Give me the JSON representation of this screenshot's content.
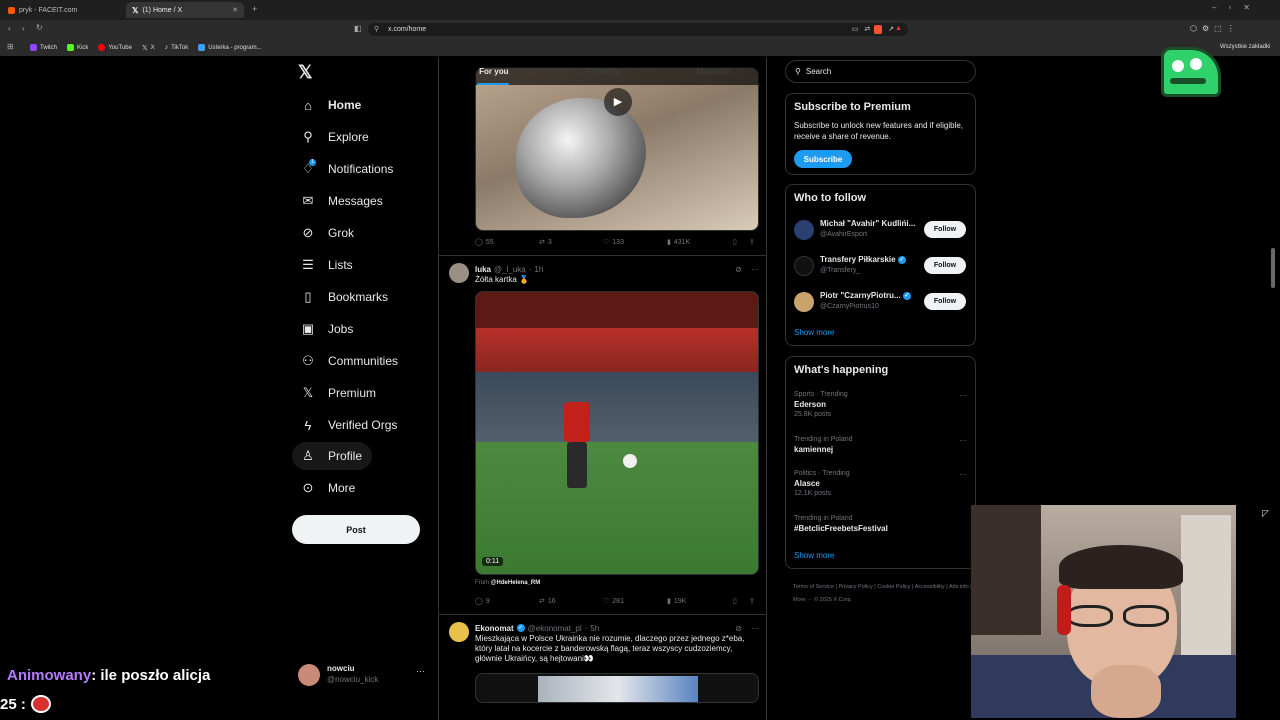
{
  "browser": {
    "tabs": [
      {
        "label": "pryk - FACEIT.com",
        "color": "#ff5500"
      },
      {
        "label": "(1) Home / X",
        "color": "#ffffff"
      }
    ],
    "url": "x.com/home",
    "bookmarks": [
      "Twitch",
      "Kick",
      "YouTube",
      "X",
      "TikTok",
      "Usterka - program..."
    ],
    "bookmarks_right": "Wszystkie zakładki"
  },
  "nav": {
    "items": [
      {
        "label": "Home",
        "icon": "home-icon"
      },
      {
        "label": "Explore",
        "icon": "search-icon"
      },
      {
        "label": "Notifications",
        "icon": "bell-icon",
        "badge": "1"
      },
      {
        "label": "Messages",
        "icon": "envelope-icon"
      },
      {
        "label": "Grok",
        "icon": "grok-icon"
      },
      {
        "label": "Lists",
        "icon": "list-icon"
      },
      {
        "label": "Bookmarks",
        "icon": "bookmark-icon"
      },
      {
        "label": "Jobs",
        "icon": "briefcase-icon"
      },
      {
        "label": "Communities",
        "icon": "people-icon"
      },
      {
        "label": "Premium",
        "icon": "x-logo-icon"
      },
      {
        "label": "Verified Orgs",
        "icon": "lightning-icon"
      },
      {
        "label": "Profile",
        "icon": "person-icon"
      },
      {
        "label": "More",
        "icon": "more-circle-icon"
      }
    ],
    "post_label": "Post",
    "account": {
      "name": "nowciu",
      "handle": "@nowciu_kick"
    }
  },
  "timeline": {
    "tabs": [
      "For you",
      "Following",
      "Mamm0n"
    ],
    "tweet1": {
      "replies": "55",
      "reposts": "3",
      "likes": "133",
      "views": "431K"
    },
    "tweet2": {
      "name": "luka",
      "handle": "@_l_uka",
      "time": "1h",
      "text": "Żółta kartka 🏅",
      "duration": "0:11",
      "from_label": "From",
      "from": "@HdeHelena_RM",
      "replies": "9",
      "reposts": "16",
      "likes": "281",
      "views": "19K"
    },
    "tweet3": {
      "name": "Ekonomat",
      "handle": "@ekonomat_pl",
      "time": "5h",
      "text": "Mieszkająca w Polsce Ukrainka nie rozumie, dlaczego przez jednego z*eba, który latał na kocercie z banderowską flagą, teraz wszyscy cudzoziemcy, głównie Ukraińcy, są hejtowani👀"
    }
  },
  "sidebar": {
    "search_placeholder": "Search",
    "premium": {
      "title": "Subscribe to Premium",
      "text": "Subscribe to unlock new features and if eligible, receive a share of revenue.",
      "button": "Subscribe"
    },
    "who_to_follow": {
      "title": "Who to follow",
      "users": [
        {
          "name": "Michał \"Avahir\" Kudlińi...",
          "handle": "@AvahirEsport"
        },
        {
          "name": "Transfery Piłkarskie",
          "handle": "@Transfery_"
        },
        {
          "name": "Piotr \"CzarnyPiotru...",
          "handle": "@CzarnyPiotrus10"
        }
      ],
      "follow_label": "Follow",
      "show_more": "Show more"
    },
    "happening": {
      "title": "What's happening",
      "items": [
        {
          "context": "Sports · Trending",
          "topic": "Ederson",
          "posts": "25.8K posts"
        },
        {
          "context": "Trending in Poland",
          "topic": "kamiennej",
          "posts": ""
        },
        {
          "context": "Politics · Trending",
          "topic": "Alasce",
          "posts": "12.1K posts"
        },
        {
          "context": "Trending in Poland",
          "topic": "#BetclicFreebetsFestival",
          "posts": ""
        }
      ],
      "show_more": "Show more"
    },
    "footer": [
      "Terms of Service",
      "Privacy Policy",
      "Cookie Policy",
      "Accessibility",
      "Ads info",
      "More ···",
      "© 2025 X Corp."
    ]
  },
  "overlay": {
    "chat_user": "Animowany",
    "chat_text": ": ile poszło alicja",
    "chat_prefix": "25 :"
  },
  "colors": {
    "accent": "#1d9bf0",
    "chat_name": "#b57cff"
  }
}
